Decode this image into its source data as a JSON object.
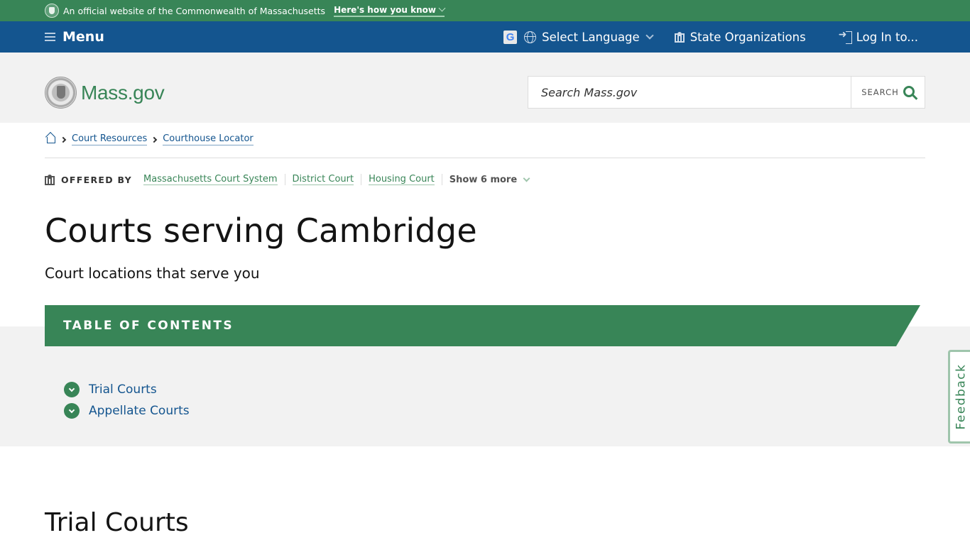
{
  "official_banner": {
    "text": "An official website of the Commonwealth of Massachusetts",
    "how_link": "Here's how you know"
  },
  "nav": {
    "menu_label": "Menu",
    "language_label": "Select Language",
    "orgs_label": "State Organizations",
    "login_label": "Log In to..."
  },
  "header": {
    "logo_text": "Mass.gov",
    "search_placeholder": "Search Mass.gov",
    "search_button": "SEARCH"
  },
  "breadcrumb": {
    "items": [
      "Court Resources",
      "Courthouse Locator"
    ]
  },
  "offered_by": {
    "label": "OFFERED BY",
    "orgs": [
      "Massachusetts Court System",
      "District Court",
      "Housing Court"
    ],
    "show_more": "Show 6 more"
  },
  "page": {
    "title": "Courts serving Cambridge",
    "subtitle": "Court locations that serve you"
  },
  "toc": {
    "title": "TABLE OF CONTENTS",
    "items": [
      "Trial Courts",
      "Appellate Courts"
    ]
  },
  "feedback_label": "Feedback",
  "section": {
    "title": "Trial Courts"
  },
  "colors": {
    "green": "#388557",
    "blue": "#14558f",
    "gray_bg": "#f2f2f2"
  }
}
